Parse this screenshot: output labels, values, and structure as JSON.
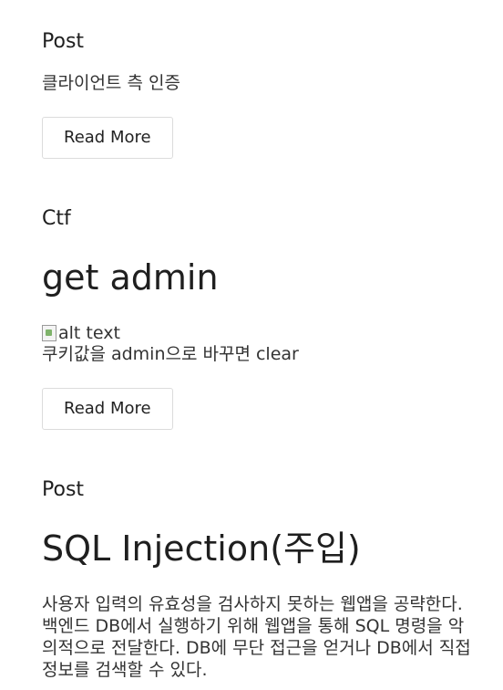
{
  "posts": [
    {
      "category": "Post",
      "summary": "클라이언트 측 인증",
      "button_label": "Read More"
    },
    {
      "category": "Ctf",
      "title": "get admin",
      "image_alt": "alt text",
      "summary": "쿠키값을 admin으로 바꾸면 clear",
      "button_label": "Read More"
    },
    {
      "category": "Post",
      "title": "SQL Injection(주입)",
      "summary": "사용자 입력의 유효성을 검사하지 못하는 웹앱을 공략한다. 백엔드 DB에서 실행하기 위해 웹앱을 통해 SQL 명령을 악의적으로 전달한다. DB에 무단 접근을 얻거나 DB에서 직접 정보를 검색할 수 있다."
    }
  ]
}
